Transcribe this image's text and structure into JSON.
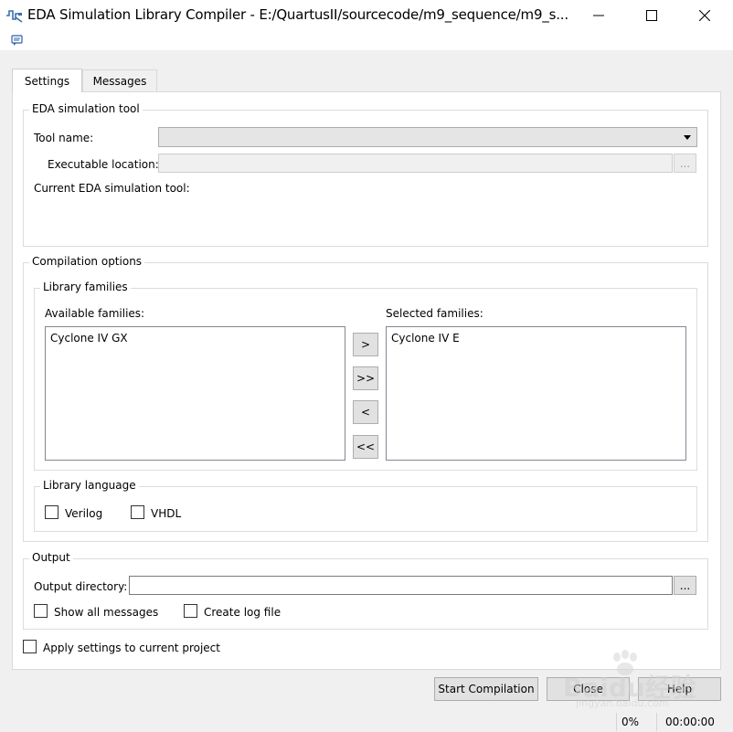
{
  "window": {
    "title": "EDA Simulation Library Compiler - E:/QuartusII/sourcecode/m9_sequence/m9_s...",
    "icons": [
      "app-icon",
      "minimize-icon",
      "maximize-icon",
      "close-icon",
      "message-icon"
    ]
  },
  "tabs": [
    {
      "label": "Settings",
      "active": true
    },
    {
      "label": "Messages",
      "active": false
    }
  ],
  "eda_tool": {
    "group_title": "EDA simulation tool",
    "tool_name_label": "Tool name:",
    "tool_name_value": "",
    "executable_label": "Executable location:",
    "executable_value": "",
    "browse_label": "...",
    "current_tool_label": "Current EDA simulation tool:"
  },
  "compilation": {
    "group_title": "Compilation options",
    "families_title": "Library families",
    "available_label": "Available families:",
    "available": [
      "Cyclone IV GX"
    ],
    "selected_label": "Selected families:",
    "selected": [
      "Cyclone IV E"
    ],
    "move_buttons": [
      ">",
      ">>",
      "<",
      "<<"
    ],
    "language_title": "Library language",
    "languages": [
      {
        "label": "Verilog",
        "checked": false
      },
      {
        "label": "VHDL",
        "checked": false
      }
    ]
  },
  "output": {
    "group_title": "Output",
    "dir_label": "Output directory:",
    "dir_value": "",
    "browse_label": "...",
    "show_all_label": "Show all messages",
    "show_all_checked": false,
    "log_label": "Create log file",
    "log_checked": false
  },
  "apply_label": "Apply settings to current project",
  "apply_checked": false,
  "buttons": {
    "start": "Start Compilation",
    "close": "Close",
    "help": "Help"
  },
  "status": {
    "progress": "0%",
    "elapsed": "00:00:00"
  },
  "watermark": {
    "brand": "Baidu经验",
    "url": "jingyan.baidu.com"
  }
}
